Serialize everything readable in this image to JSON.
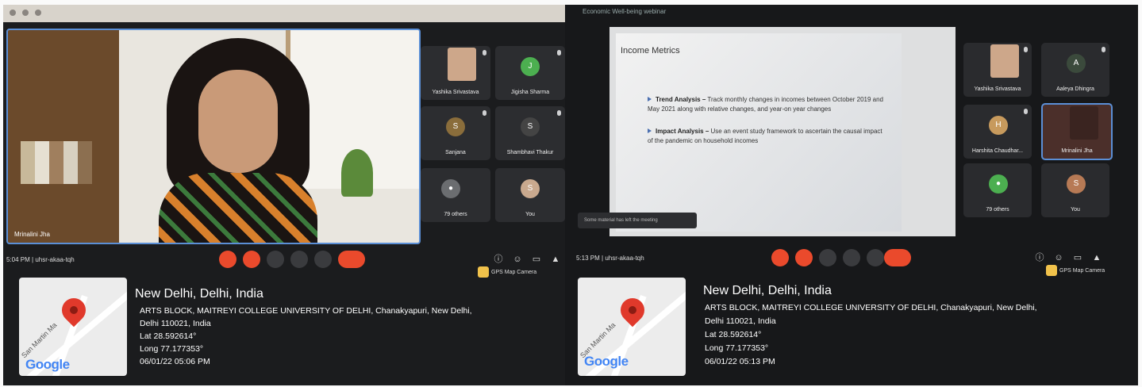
{
  "left": {
    "meet_code": "uhsr-akaa-tqh",
    "time": "5:04 PM",
    "main_speaker": "Mrinalini Jha",
    "tiles": [
      {
        "name": "Yashika Srivastava",
        "kind": "photo"
      },
      {
        "name": "Jigisha Sharma",
        "kind": "avatar",
        "initial": "J",
        "color": "#4caf50"
      },
      {
        "name": "Sanjana",
        "kind": "avatar",
        "initial": "S",
        "color": "#8a6d3b"
      },
      {
        "name": "Shambhavi Thakur",
        "kind": "avatar",
        "initial": "S",
        "color": "#444"
      },
      {
        "name": "79 others",
        "kind": "group"
      },
      {
        "name": "You",
        "kind": "avatar",
        "initial": "S",
        "color": "#c9a98e"
      }
    ],
    "gps_camera_label": "GPS Map Camera",
    "geotag": {
      "city": "New Delhi, Delhi, India",
      "address_line1": "ARTS BLOCK, MAITREYI COLLEGE UNIVERSITY OF DELHI, Chanakyapuri, New Delhi,",
      "address_line2": "Delhi 110021, India",
      "lat": "Lat 28.592614°",
      "long": "Long 77.177353°",
      "datetime": "06/01/22 05:06 PM",
      "map_road": "San Martin Ma",
      "map_logo": "Google"
    }
  },
  "right": {
    "window_title": "Economic Well-being webinar",
    "meet_code": "uhsr-akaa-tqh",
    "time": "5:13 PM",
    "slide": {
      "title": "Income Metrics",
      "bullets": [
        {
          "head": "Trend Analysis –",
          "text": "Track monthly changes in incomes between October 2019 and May 2021 along with relative changes, and year-on year changes"
        },
        {
          "head": "Impact Analysis –",
          "text": "Use an event study framework to ascertain the causal impact of the pandemic on household incomes"
        }
      ]
    },
    "toast": "Some material has left the meeting",
    "tiles": [
      {
        "name": "Yashika Srivastava",
        "kind": "photo"
      },
      {
        "name": "Aaleya Dhingra",
        "kind": "avatar",
        "initial": "A",
        "color": "#3b4a3c"
      },
      {
        "name": "Harshita Chaudhar...",
        "kind": "avatar",
        "initial": "H",
        "color": "#c79a5d"
      },
      {
        "name": "Mrinalini Jha",
        "kind": "active"
      },
      {
        "name": "79 others",
        "kind": "group"
      },
      {
        "name": "You",
        "kind": "avatar",
        "initial": "S",
        "color": "#b77a55"
      }
    ],
    "gps_camera_label": "GPS Map Camera",
    "geotag": {
      "city": "New Delhi, Delhi, India",
      "address_line1": "ARTS BLOCK, MAITREYI COLLEGE UNIVERSITY OF DELHI, Chanakyapuri, New Delhi,",
      "address_line2": "Delhi 110021, India",
      "lat": "Lat 28.592614°",
      "long": "Long 77.177353°",
      "datetime": "06/01/22 05:13 PM",
      "map_road": "San Martin Ma",
      "map_logo": "Google"
    }
  },
  "colors": {
    "end_call": "#ea4a2c",
    "active_border": "#5b8fd6",
    "pin": "#e0392b"
  }
}
